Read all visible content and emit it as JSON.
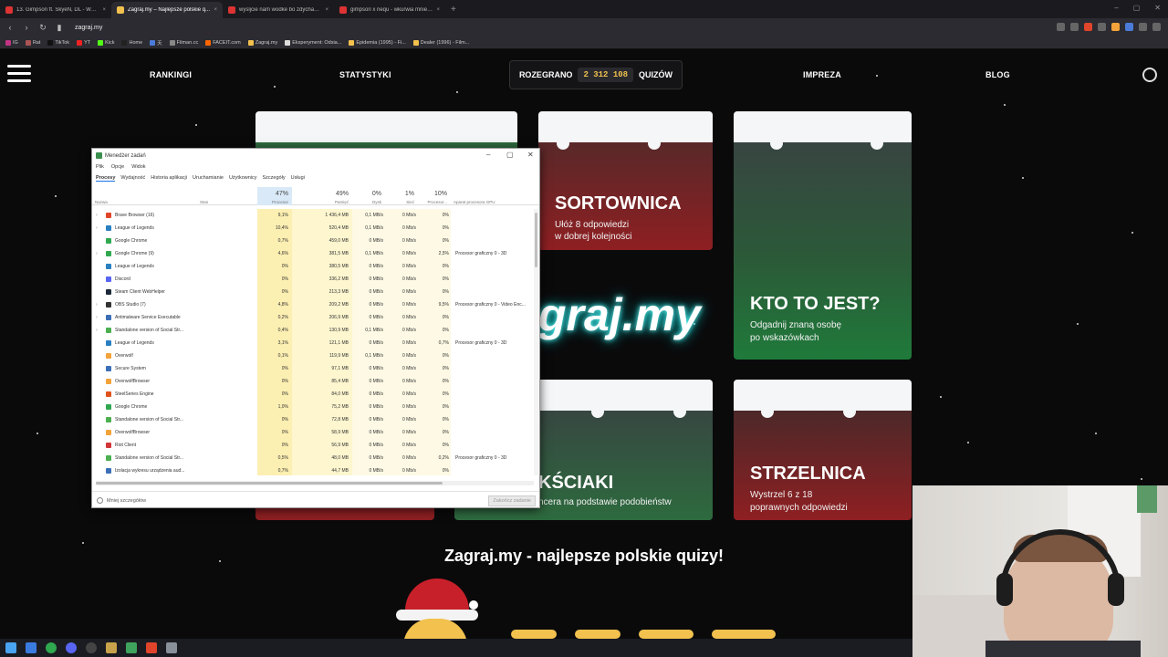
{
  "browser": {
    "tabs": [
      {
        "title": "13. Gimpson ft. SkyeN, DL - Wkurwi...",
        "color": "#d33",
        "active": false
      },
      {
        "title": "Zagraj.my – Najlepsze polskie q...",
        "color": "#f2c14e",
        "active": true
      },
      {
        "title": "wysljcie nam wodke bo zdychamy n...",
        "color": "#d33",
        "active": false
      },
      {
        "title": "gimpson x nequ - wkurwia mnie (Ly...",
        "color": "#d33",
        "active": false
      }
    ],
    "url": "zagraj.my",
    "bookmarks": [
      {
        "label": "IG",
        "color": "#c13584"
      },
      {
        "label": "Rat",
        "color": "#a55"
      },
      {
        "label": "TikTok",
        "color": "#111"
      },
      {
        "label": "YT",
        "color": "#e22"
      },
      {
        "label": "Kick",
        "color": "#53fc18"
      },
      {
        "label": "Home",
        "color": "#222"
      },
      {
        "label": "天",
        "color": "#4b7bd8"
      },
      {
        "label": "Filman.cc",
        "color": "#888"
      },
      {
        "label": "FACEIT.com",
        "color": "#f60"
      },
      {
        "label": "Zagraj.my",
        "color": "#f2c14e"
      },
      {
        "label": "Eksperyment: Odsia...",
        "color": "#ddd"
      },
      {
        "label": "Epidemia (1995) - Fi...",
        "color": "#f2c14e"
      },
      {
        "label": "Dealer (1996) - Film...",
        "color": "#f2c14e"
      }
    ]
  },
  "site": {
    "nav": {
      "rankingi": "RANKINGI",
      "statystyki": "STATYSTYKI",
      "rozegrano": "ROZEGRANO",
      "count": "2 312 108",
      "quizow": "QUIZÓW",
      "impreza": "IMPREZA",
      "blog": "BLOG"
    },
    "cards": {
      "sortownica": {
        "title": "SORTOWNICA",
        "desc1": "Ułóż 8 odpowiedzi",
        "desc2": "w dobrej kolejności"
      },
      "ktotojest": {
        "title": "KTO TO JEST?",
        "desc1": "Odgadnij znaną osobę",
        "desc2": "po wskazówkach"
      },
      "skojarzenia": {
        "title": "KŚCIAKI",
        "desc1": "ncera na podstawie podobieństw"
      },
      "strzelnica": {
        "title": "STRZELNICA",
        "desc1": "Wystrzel 6 z 18",
        "desc2": "poprawnych odpowiedzi"
      }
    },
    "logo_text": "graj.my",
    "tagline": "Zagraj.my - najlepsze polskie quizy!"
  },
  "taskmgr": {
    "title": "Menedżer zadań",
    "menu": [
      "Plik",
      "Opcje",
      "Widok"
    ],
    "tabs": [
      "Procesy",
      "Wydajność",
      "Historia aplikacji",
      "Uruchamianie",
      "Użytkownicy",
      "Szczegóły",
      "Usługi"
    ],
    "columns": {
      "name": "Nazwa",
      "status": "Stan",
      "cpu_pct": "47%",
      "cpu": "Procesor",
      "mem_pct": "49%",
      "mem": "Pamięć",
      "disk_pct": "0%",
      "disk": "Dysk",
      "net_pct": "1%",
      "net": "Sieć",
      "gpu_pct": "10%",
      "gpu": "Procesor...",
      "gpu_engine": "Aparat procesora GPU"
    },
    "rows": [
      {
        "exp": "›",
        "icon": "#e0452b",
        "name": "Brave Browser (16)",
        "cpu": "9,1%",
        "mem": "1 436,4 MB",
        "disk": "0,1 MB/s",
        "net": "0 Mb/s",
        "gpu": "0%",
        "engine": ""
      },
      {
        "exp": "›",
        "icon": "#2a7fc1",
        "name": "League of Legends",
        "cpu": "10,4%",
        "mem": "520,4 MB",
        "disk": "0,1 MB/s",
        "net": "0 Mb/s",
        "gpu": "0%",
        "engine": ""
      },
      {
        "exp": "",
        "icon": "#2fa84f",
        "name": "Google Chrome",
        "cpu": "0,7%",
        "mem": "459,0 MB",
        "disk": "0 MB/s",
        "net": "0 Mb/s",
        "gpu": "0%",
        "engine": ""
      },
      {
        "exp": "›",
        "icon": "#2fa84f",
        "name": "Google Chrome (9)",
        "cpu": "4,6%",
        "mem": "381,5 MB",
        "disk": "0,1 MB/s",
        "net": "0 Mb/s",
        "gpu": "2,5%",
        "engine": "Procesor graficzny 0 - 3D"
      },
      {
        "exp": "",
        "icon": "#2a7fc1",
        "name": "League of Legends",
        "cpu": "0%",
        "mem": "380,5 MB",
        "disk": "0 MB/s",
        "net": "0 Mb/s",
        "gpu": "0%",
        "engine": ""
      },
      {
        "exp": "",
        "icon": "#5865f2",
        "name": "Discord",
        "cpu": "0%",
        "mem": "336,2 MB",
        "disk": "0 MB/s",
        "net": "0 Mb/s",
        "gpu": "0%",
        "engine": ""
      },
      {
        "exp": "",
        "icon": "#1b2838",
        "name": "Steam Client WebHelper",
        "cpu": "0%",
        "mem": "213,3 MB",
        "disk": "0 MB/s",
        "net": "0 Mb/s",
        "gpu": "0%",
        "engine": ""
      },
      {
        "exp": "›",
        "icon": "#333",
        "name": "OBS Studio (7)",
        "cpu": "4,8%",
        "mem": "209,2 MB",
        "disk": "0 MB/s",
        "net": "0 Mb/s",
        "gpu": "9,5%",
        "engine": "Procesor graficzny 0 - Video Enc..."
      },
      {
        "exp": "›",
        "icon": "#3b6fb6",
        "name": "Antimalware Service Executable",
        "cpu": "0,2%",
        "mem": "206,9 MB",
        "disk": "0 MB/s",
        "net": "0 Mb/s",
        "gpu": "0%",
        "engine": ""
      },
      {
        "exp": "›",
        "icon": "#4caf50",
        "name": "Standalone version of Social Str...",
        "cpu": "0,4%",
        "mem": "130,9 MB",
        "disk": "0,1 MB/s",
        "net": "0 Mb/s",
        "gpu": "0%",
        "engine": ""
      },
      {
        "exp": "",
        "icon": "#2a7fc1",
        "name": "League of Legends",
        "cpu": "3,1%",
        "mem": "121,1 MB",
        "disk": "0 MB/s",
        "net": "0 Mb/s",
        "gpu": "0,7%",
        "engine": "Procesor graficzny 0 - 3D"
      },
      {
        "exp": "",
        "icon": "#f2a33a",
        "name": "Overwolf",
        "cpu": "0,1%",
        "mem": "119,9 MB",
        "disk": "0,1 MB/s",
        "net": "0 Mb/s",
        "gpu": "0%",
        "engine": ""
      },
      {
        "exp": "",
        "icon": "#3b6fb6",
        "name": "Secure System",
        "cpu": "0%",
        "mem": "97,1 MB",
        "disk": "0 MB/s",
        "net": "0 Mb/s",
        "gpu": "0%",
        "engine": ""
      },
      {
        "exp": "",
        "icon": "#f2a33a",
        "name": "OverwolfBrowser",
        "cpu": "0%",
        "mem": "85,4 MB",
        "disk": "0 MB/s",
        "net": "0 Mb/s",
        "gpu": "0%",
        "engine": ""
      },
      {
        "exp": "",
        "icon": "#e0521b",
        "name": "SteelSeries Engine",
        "cpu": "0%",
        "mem": "84,0 MB",
        "disk": "0 MB/s",
        "net": "0 Mb/s",
        "gpu": "0%",
        "engine": ""
      },
      {
        "exp": "",
        "icon": "#2fa84f",
        "name": "Google Chrome",
        "cpu": "1,0%",
        "mem": "75,2 MB",
        "disk": "0 MB/s",
        "net": "0 Mb/s",
        "gpu": "0%",
        "engine": ""
      },
      {
        "exp": "",
        "icon": "#4caf50",
        "name": "Standalone version of Social Str...",
        "cpu": "0%",
        "mem": "72,8 MB",
        "disk": "0 MB/s",
        "net": "0 Mb/s",
        "gpu": "0%",
        "engine": ""
      },
      {
        "exp": "",
        "icon": "#f2a33a",
        "name": "OverwolfBrowser",
        "cpu": "0%",
        "mem": "58,9 MB",
        "disk": "0 MB/s",
        "net": "0 Mb/s",
        "gpu": "0%",
        "engine": ""
      },
      {
        "exp": "",
        "icon": "#d13639",
        "name": "Riot Client",
        "cpu": "0%",
        "mem": "56,9 MB",
        "disk": "0 MB/s",
        "net": "0 Mb/s",
        "gpu": "0%",
        "engine": ""
      },
      {
        "exp": "",
        "icon": "#4caf50",
        "name": "Standalone version of Social Str...",
        "cpu": "0,5%",
        "mem": "48,0 MB",
        "disk": "0 MB/s",
        "net": "0 Mb/s",
        "gpu": "0,2%",
        "engine": "Procesor graficzny 0 - 3D"
      },
      {
        "exp": "",
        "icon": "#3b6fb6",
        "name": "Izolacja wykresu urządzenia aud...",
        "cpu": "0,7%",
        "mem": "44,7 MB",
        "disk": "0 MB/s",
        "net": "0 Mb/s",
        "gpu": "0%",
        "engine": ""
      }
    ],
    "fewer_details": "Mniej szczegółów",
    "end_task": "Zakończ zadanie"
  }
}
